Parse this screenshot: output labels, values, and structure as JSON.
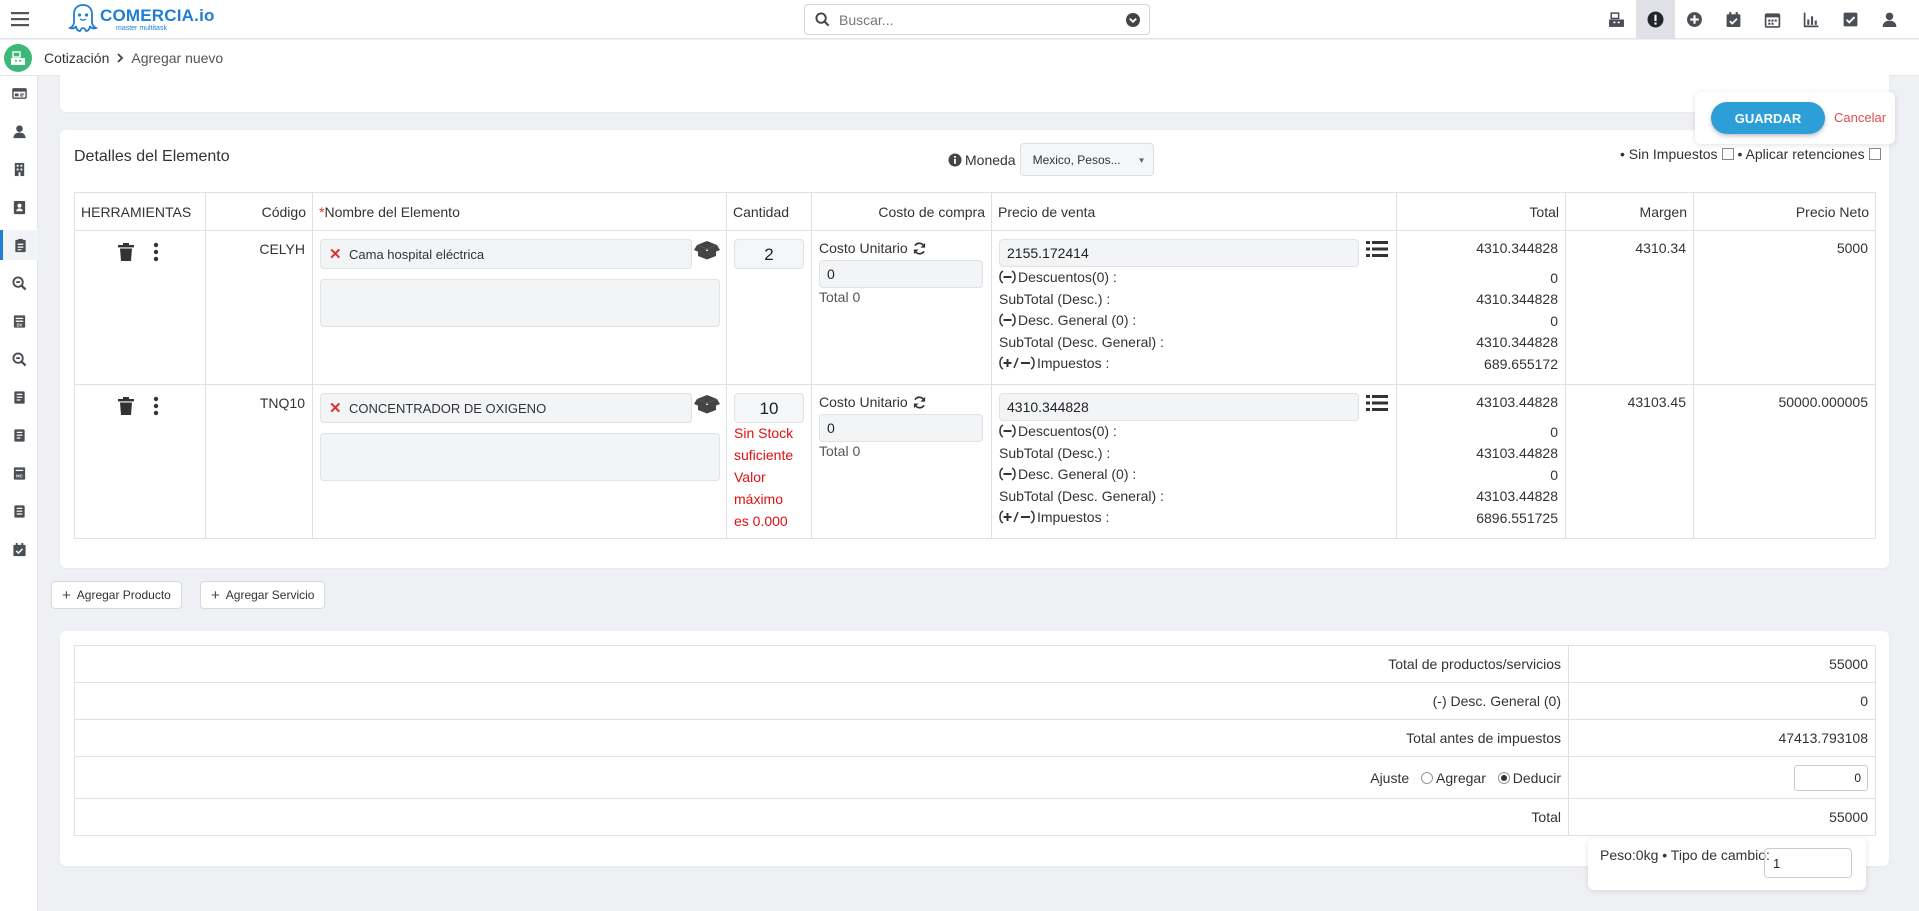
{
  "app": {
    "logo_name": "COMERCIA.io",
    "logo_sub": "master multitask",
    "brand_color": "#1f7ed4"
  },
  "search": {
    "placeholder": "Buscar..."
  },
  "topbar_icons": [
    "cash-register-icon",
    "alert-icon",
    "plus-circle-icon",
    "calendar-check-icon",
    "calendar-icon",
    "chart-icon",
    "check-square-icon",
    "user-icon"
  ],
  "breadcrumb": {
    "parent": "Cotización",
    "current": "Agregar nuevo"
  },
  "sidebar_icons": [
    "id-card-icon",
    "user-icon",
    "building-icon",
    "contact-icon",
    "clipboard-icon",
    "search-icon",
    "badge-icon",
    "search-alt-icon",
    "book-icon",
    "book-alt-icon",
    "hc-icon",
    "receipt-icon",
    "calendar-check-icon"
  ],
  "actions": {
    "save_label": "GUARDAR",
    "cancel_label": "Cancelar",
    "save_color": "#2c9ed8"
  },
  "details": {
    "title": "Detalles del Elemento",
    "currency_label": "Moneda",
    "currency_value": "Mexico, Pesos...",
    "no_tax_label": "• Sin Impuestos",
    "withholding_label": "• Aplicar retenciones"
  },
  "table": {
    "headers": {
      "tools": "HERRAMIENTAS",
      "code": "Código",
      "name_req": "*",
      "name": "Nombre del Elemento",
      "qty": "Cantidad",
      "cost": "Costo de compra",
      "price": "Precio de venta",
      "total": "Total",
      "margin": "Margen",
      "net": "Precio Neto"
    },
    "rows": [
      {
        "code": "CELYH",
        "name": "Cama hospital eléctrica",
        "qty": "2",
        "warning": [],
        "unit_cost_label": "Costo Unitario",
        "unit_cost": "0",
        "cost_total": "Total 0",
        "price": "2155.172414",
        "disc_label": "Descuentos(0) :",
        "subtotal_label": "SubTotal (Desc.) :",
        "gen_disc_label": "Desc. General (0) :",
        "gen_subtotal_label": "SubTotal (Desc. General) :",
        "tax_label": "Impuestos :",
        "totals": [
          "4310.344828",
          "0",
          "4310.344828",
          "0",
          "4310.344828",
          "689.655172"
        ],
        "margin": "4310.34",
        "net": "5000"
      },
      {
        "code": "TNQ10",
        "name": "CONCENTRADOR DE OXIGENO",
        "qty": "10",
        "warning": [
          "Sin Stock",
          "suficiente",
          "Valor",
          "máximo",
          "es 0.000"
        ],
        "unit_cost_label": "Costo Unitario",
        "unit_cost": "0",
        "cost_total": "Total 0",
        "price": "4310.344828",
        "disc_label": "Descuentos(0) :",
        "subtotal_label": "SubTotal (Desc.) :",
        "gen_disc_label": "Desc. General (0) :",
        "gen_subtotal_label": "SubTotal (Desc. General) :",
        "tax_label": "Impuestos :",
        "totals": [
          "43103.44828",
          "0",
          "43103.44828",
          "0",
          "43103.44828",
          "6896.551725"
        ],
        "margin": "43103.45",
        "net": "50000.000005"
      }
    ]
  },
  "buttons": {
    "add_product": "Agregar Producto",
    "add_service": "Agregar Servicio"
  },
  "summary": {
    "products_label": "Total de productos/servicios",
    "products_value": "55000",
    "gen_disc_label": "(-) Desc. General (0)",
    "gen_disc_value": "0",
    "before_tax_label": "Total antes de impuestos",
    "before_tax_value": "47413.793108",
    "adjust_label": "Ajuste",
    "add_label": "Agregar",
    "deduct_label": "Deducir",
    "adjust_value": "0",
    "total_label": "Total",
    "total_value": "55000"
  },
  "footer": {
    "weight_label": "Peso:0kg • Tipo de cambio:",
    "exchange_rate": "1"
  }
}
